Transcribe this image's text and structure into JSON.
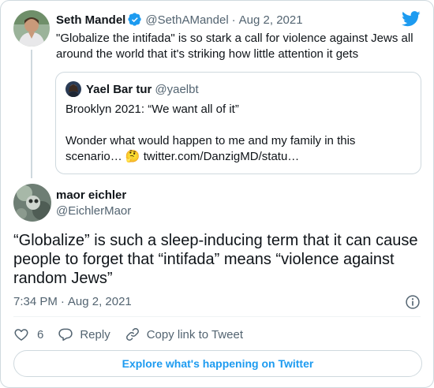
{
  "colors": {
    "brand": "#1d9bf0",
    "text": "#0f1419",
    "muted": "#536471",
    "border": "#cfd9de"
  },
  "parent_tweet": {
    "author_name": "Seth Mandel",
    "verified_icon": "verified-badge-icon",
    "handle": "@SethAMandel",
    "separator": "·",
    "date": "Aug 2, 2021",
    "text": "\"Globalize the intifada\" is so stark a call for violence against Jews all around the world that it's striking how little attention it gets"
  },
  "quoted_tweet": {
    "author_name": "Yael Bar tur",
    "handle": "@yaelbt",
    "line1": "Brooklyn 2021: “We want all of it”",
    "line2_text": "Wonder what would happen to me and my family in this scenario… ",
    "emoji": "🤔",
    "link": "twitter.com/DanzigMD/statu…"
  },
  "main_tweet": {
    "author_name": "maor eichler",
    "handle": "@EichlerMaor",
    "text": "“Globalize” is such a sleep-inducing term that it can cause people to forget that “intifada” means “violence against random Jews”",
    "time": "7:34 PM",
    "separator": "·",
    "date": "Aug 2, 2021"
  },
  "actions": {
    "like_count": "6",
    "reply_label": "Reply",
    "copy_link_label": "Copy link to Tweet"
  },
  "footer": {
    "explore_label": "Explore what's happening on Twitter"
  }
}
